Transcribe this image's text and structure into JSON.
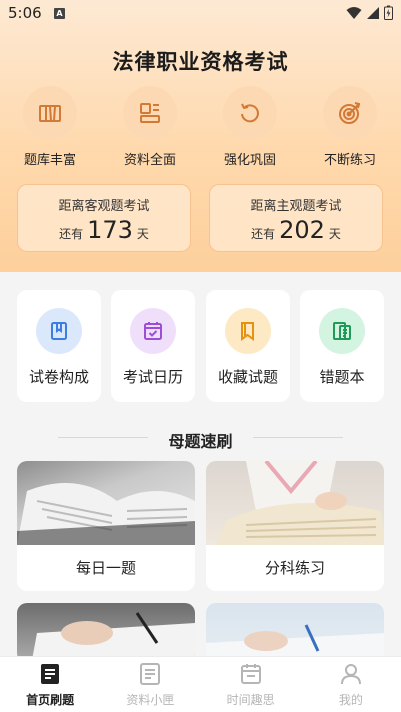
{
  "status_bar": {
    "time": "5:06",
    "notification_icon": "A"
  },
  "header": {
    "title": "法律职业资格考试"
  },
  "features": [
    {
      "label": "题库丰富",
      "icon": "books-icon"
    },
    {
      "label": "资料全面",
      "icon": "layout-icon"
    },
    {
      "label": "强化巩固",
      "icon": "refresh-icon"
    },
    {
      "label": "不断练习",
      "icon": "target-icon"
    }
  ],
  "countdowns": [
    {
      "title": "距离客观题考试",
      "prefix": "还有",
      "days": "173",
      "unit": "天"
    },
    {
      "title": "距离主观题考试",
      "prefix": "还有",
      "days": "202",
      "unit": "天"
    }
  ],
  "tools": [
    {
      "label": "试卷构成",
      "icon": "bookmark-icon",
      "color": "#3b7de0",
      "bg": "#dbe8fb"
    },
    {
      "label": "考试日历",
      "icon": "calendar-icon",
      "color": "#9b4fd8",
      "bg": "#efdffb"
    },
    {
      "label": "收藏试题",
      "icon": "collection-icon",
      "color": "#e8910f",
      "bg": "#fde9c4"
    },
    {
      "label": "错题本",
      "icon": "notebook-icon",
      "color": "#1f9a58",
      "bg": "#d3f4e1"
    }
  ],
  "section": {
    "title": "母题速刷"
  },
  "cards": [
    {
      "label": "每日一题"
    },
    {
      "label": "分科练习"
    },
    {
      "label": ""
    },
    {
      "label": ""
    }
  ],
  "tabbar": [
    {
      "label": "首页刷题",
      "active": true
    },
    {
      "label": "资料小匣",
      "active": false
    },
    {
      "label": "时间趣思",
      "active": false
    },
    {
      "label": "我的",
      "active": false
    }
  ]
}
